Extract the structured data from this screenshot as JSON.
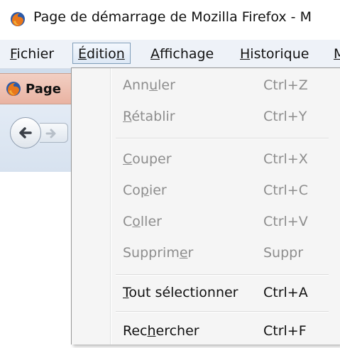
{
  "window": {
    "title": "Page de démarrage de Mozilla Firefox - M"
  },
  "menubar": {
    "items": [
      {
        "label_u": "F",
        "label_rest": "ichier"
      },
      {
        "label_u": "É",
        "label_mid": "ditio",
        "label_u2": "n",
        "active": true
      },
      {
        "label_u": "A",
        "label_rest": "ffichage"
      },
      {
        "label_u": "H",
        "label_rest": "istorique"
      },
      {
        "label_u": "M",
        "label_rest": ""
      }
    ]
  },
  "tab": {
    "label": "Page"
  },
  "edit_menu": {
    "items": [
      {
        "pre": "Ann",
        "u": "u",
        "post": "ler",
        "shortcut": "Ctrl+Z",
        "disabled": true
      },
      {
        "pre": "",
        "u": "R",
        "post": "établir",
        "shortcut": "Ctrl+Y",
        "disabled": true
      },
      {
        "pre": "",
        "u": "C",
        "post": "ouper",
        "shortcut": "Ctrl+X",
        "disabled": true
      },
      {
        "pre": "Co",
        "u": "p",
        "post": "ier",
        "shortcut": "Ctrl+C",
        "disabled": true
      },
      {
        "pre": "C",
        "u": "o",
        "post": "ller",
        "shortcut": "Ctrl+V",
        "disabled": true
      },
      {
        "pre": "Supprim",
        "u": "e",
        "post": "r",
        "shortcut": "Suppr",
        "disabled": true
      },
      {
        "pre": "",
        "u": "T",
        "post": "out sélectionner",
        "shortcut": "Ctrl+A",
        "disabled": false
      },
      {
        "pre": "Rec",
        "u": "h",
        "post": "ercher",
        "shortcut": "Ctrl+F",
        "disabled": false
      }
    ]
  },
  "icons": {
    "app": "firefox-logo-icon",
    "back": "back-arrow-icon",
    "forward": "forward-arrow-icon"
  }
}
